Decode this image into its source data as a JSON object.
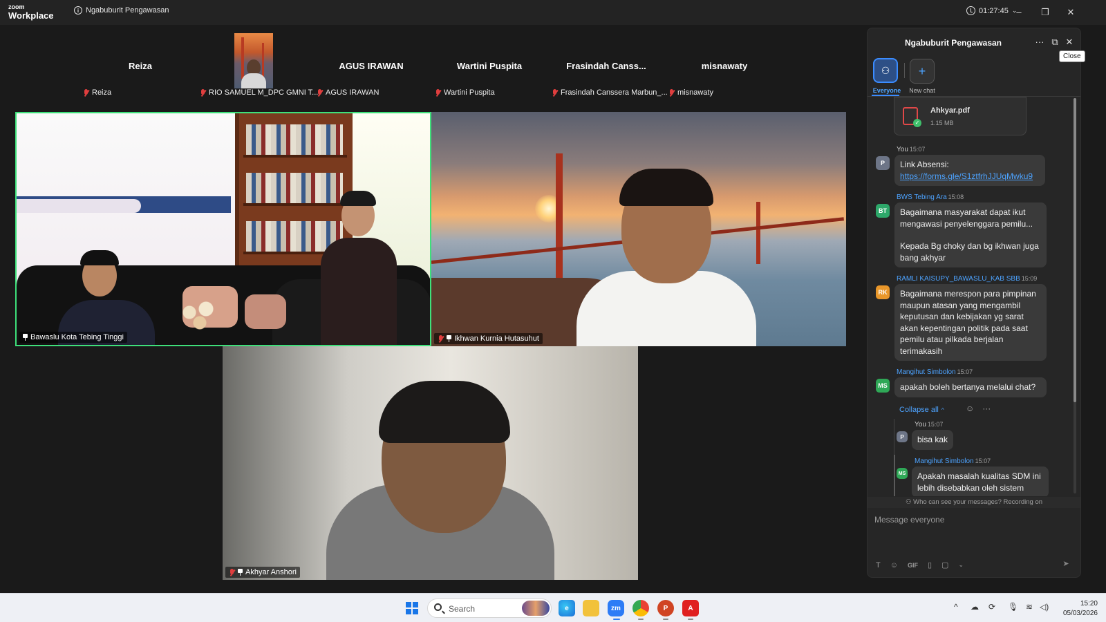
{
  "titlebar": {
    "brand_line1": "zoom",
    "brand_line2": "Workplace",
    "meeting_title": "Ngabuburit Pengawasan",
    "timer": "01:27:45",
    "minimize": "–",
    "restore": "❐",
    "close": "✕"
  },
  "strip": [
    {
      "name": "Reiza",
      "label": "Reiza",
      "video": false
    },
    {
      "name": "",
      "label": "RIO SAMUEL M_DPC GMNI T...",
      "video": true
    },
    {
      "name": "AGUS IRAWAN",
      "label": "AGUS IRAWAN",
      "video": false
    },
    {
      "name": "Wartini Puspita",
      "label": "Wartini Puspita",
      "video": false
    },
    {
      "name": "Frasindah  Canss...",
      "label": "Frasindah Canssera Marbun_...",
      "video": false
    },
    {
      "name": "misnawaty",
      "label": "misnawaty",
      "video": false
    }
  ],
  "tiles": {
    "tile1": {
      "label": "Bawaslu Kota Tebing Tinggi",
      "active_speaker": true
    },
    "tile2": {
      "label": "Ikhwan Kurnia Hutasuhut"
    },
    "tile3": {
      "label": "Akhyar Anshori"
    }
  },
  "chat": {
    "title": "Ngabuburit Pengawasan",
    "more": "···",
    "popout": "⧉",
    "close": "✕",
    "close_tooltip": "Close",
    "tabs": {
      "everyone": "Everyone",
      "new_chat": "New chat"
    },
    "file": {
      "name": "Ahkyar.pdf",
      "size": "1.15 MB"
    },
    "messages": [
      {
        "avatar": "P",
        "sender": "You",
        "time": "15:07",
        "text": "Link Absensi:",
        "link": "https://forms.gle/S1ztfrhJJUqMwku9"
      },
      {
        "avatar": "BT",
        "sender": "BWS Tebing Ara",
        "time": "15:08",
        "text": "Bagaimana masyarakat dapat ikut mengawasi penyelenggara pemilu...",
        "text2": "Kepada Bg choky dan bg ikhwan juga bang akhyar"
      },
      {
        "avatar": "RK",
        "sender": "RAMLI KAISUPY_BAWASLU_KAB SBB",
        "time": "15:09",
        "text": "Bagaimana merespon para pimpinan maupun atasan yang mengambil keputusan dan kebijakan yg sarat akan kepentingan politik pada saat pemilu atau pilkada berjalan terimakasih"
      },
      {
        "avatar": "MS",
        "sender": "Mangihut Simbolon",
        "time": "15:07",
        "text": "apakah boleh bertanya melalui chat?"
      }
    ],
    "collapse_all": "Collapse all",
    "thread": [
      {
        "avatar": "P",
        "sender": "You",
        "time": "15:07",
        "text": "bisa kak"
      },
      {
        "avatar": "MS",
        "sender": "Mangihut Simbolon",
        "time": "15:07",
        "text": "Apakah masalah kualitas SDM ini lebih disebabkan oleh sistem"
      }
    ],
    "notice": "Who can see your messages? Recording on",
    "input_placeholder": "Message everyone",
    "tools": {
      "gif": "GIF"
    }
  },
  "taskbar": {
    "search": "Search",
    "time": "15:20",
    "date": "05/03/2026"
  }
}
